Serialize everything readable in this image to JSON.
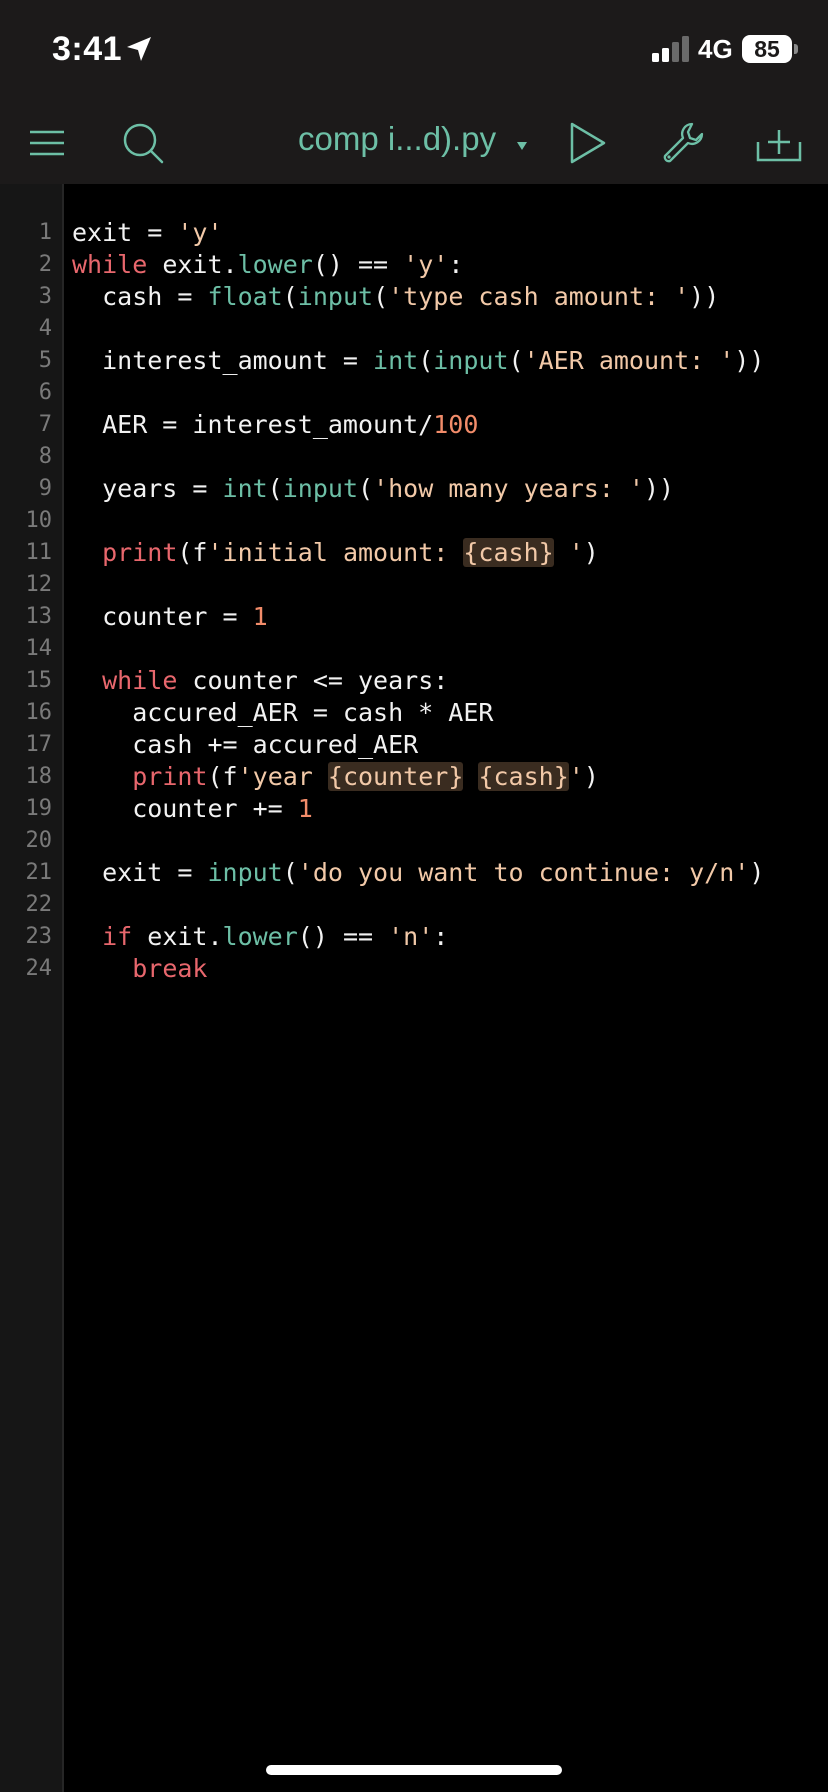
{
  "status_bar": {
    "time": "3:41",
    "network": "4G",
    "battery": "85",
    "icons": [
      "location-arrow-icon",
      "signal-bars-icon"
    ]
  },
  "toolbar": {
    "file_title": "comp i...d).py",
    "icons": [
      "menu-icon",
      "search-icon",
      "dropdown-caret-icon",
      "run-icon",
      "wrench-icon",
      "new-file-icon"
    ],
    "accent_color": "#6dbfa6"
  },
  "editor": {
    "colors": {
      "keyword": "#e8676d",
      "function": "#6dbfa6",
      "string": "#f2c9a8",
      "number": "#f28c6a",
      "text": "#f2f2f2",
      "line_number": "#7a7a7a"
    },
    "lines": [
      {
        "n": "1",
        "tokens": [
          {
            "t": "exit = ",
            "k": "txt"
          },
          {
            "t": "'y'",
            "k": "str"
          }
        ]
      },
      {
        "n": "2",
        "tokens": [
          {
            "t": "while",
            "k": "kw"
          },
          {
            "t": " exit.",
            "k": "txt"
          },
          {
            "t": "lower",
            "k": "fn"
          },
          {
            "t": "() == ",
            "k": "txt"
          },
          {
            "t": "'y'",
            "k": "str"
          },
          {
            "t": ":",
            "k": "txt"
          }
        ]
      },
      {
        "n": "3",
        "tokens": [
          {
            "t": "  cash = ",
            "k": "txt"
          },
          {
            "t": "float",
            "k": "fn"
          },
          {
            "t": "(",
            "k": "txt"
          },
          {
            "t": "input",
            "k": "fn"
          },
          {
            "t": "(",
            "k": "txt"
          },
          {
            "t": "'type cash amount: '",
            "k": "str"
          },
          {
            "t": "))",
            "k": "txt"
          }
        ]
      },
      {
        "n": "4",
        "tokens": []
      },
      {
        "n": "5",
        "tokens": [
          {
            "t": "  interest_amount = ",
            "k": "txt"
          },
          {
            "t": "int",
            "k": "fn"
          },
          {
            "t": "(",
            "k": "txt"
          },
          {
            "t": "input",
            "k": "fn"
          },
          {
            "t": "(",
            "k": "txt"
          },
          {
            "t": "'AER amount: '",
            "k": "str"
          },
          {
            "t": "))",
            "k": "txt"
          }
        ]
      },
      {
        "n": "6",
        "tokens": []
      },
      {
        "n": "7",
        "tokens": [
          {
            "t": "  AER = interest_amount/",
            "k": "txt"
          },
          {
            "t": "100",
            "k": "num"
          }
        ]
      },
      {
        "n": "8",
        "tokens": []
      },
      {
        "n": "9",
        "tokens": [
          {
            "t": "  years = ",
            "k": "txt"
          },
          {
            "t": "int",
            "k": "fn"
          },
          {
            "t": "(",
            "k": "txt"
          },
          {
            "t": "input",
            "k": "fn"
          },
          {
            "t": "(",
            "k": "txt"
          },
          {
            "t": "'how many years: '",
            "k": "str"
          },
          {
            "t": "))",
            "k": "txt"
          }
        ]
      },
      {
        "n": "10",
        "tokens": []
      },
      {
        "n": "11",
        "tokens": [
          {
            "t": "  ",
            "k": "txt"
          },
          {
            "t": "print",
            "k": "kw"
          },
          {
            "t": "(f",
            "k": "txt"
          },
          {
            "t": "'initial amount: ",
            "k": "str"
          },
          {
            "t": "{cash}",
            "k": "interp"
          },
          {
            "t": " '",
            "k": "str"
          },
          {
            "t": ")",
            "k": "txt"
          }
        ]
      },
      {
        "n": "12",
        "tokens": []
      },
      {
        "n": "13",
        "tokens": [
          {
            "t": "  counter = ",
            "k": "txt"
          },
          {
            "t": "1",
            "k": "num"
          }
        ]
      },
      {
        "n": "14",
        "tokens": []
      },
      {
        "n": "15",
        "tokens": [
          {
            "t": "  ",
            "k": "txt"
          },
          {
            "t": "while",
            "k": "kw"
          },
          {
            "t": " counter <= years:",
            "k": "txt"
          }
        ]
      },
      {
        "n": "16",
        "tokens": [
          {
            "t": "    accured_AER = cash * AER",
            "k": "txt"
          }
        ]
      },
      {
        "n": "17",
        "tokens": [
          {
            "t": "    cash += accured_AER",
            "k": "txt"
          }
        ]
      },
      {
        "n": "18",
        "tokens": [
          {
            "t": "    ",
            "k": "txt"
          },
          {
            "t": "print",
            "k": "kw"
          },
          {
            "t": "(f",
            "k": "txt"
          },
          {
            "t": "'year ",
            "k": "str"
          },
          {
            "t": "{counter}",
            "k": "interp"
          },
          {
            "t": " ",
            "k": "str"
          },
          {
            "t": "{cash}",
            "k": "interp"
          },
          {
            "t": "'",
            "k": "str"
          },
          {
            "t": ")",
            "k": "txt"
          }
        ]
      },
      {
        "n": "19",
        "tokens": [
          {
            "t": "    counter += ",
            "k": "txt"
          },
          {
            "t": "1",
            "k": "num"
          }
        ]
      },
      {
        "n": "20",
        "tokens": []
      },
      {
        "n": "21",
        "tokens": [
          {
            "t": "  exit = ",
            "k": "txt"
          },
          {
            "t": "input",
            "k": "fn"
          },
          {
            "t": "(",
            "k": "txt"
          },
          {
            "t": "'do you want to continue: y/n'",
            "k": "str"
          },
          {
            "t": ")",
            "k": "txt"
          }
        ]
      },
      {
        "n": "22",
        "tokens": []
      },
      {
        "n": "23",
        "tokens": [
          {
            "t": "  ",
            "k": "txt"
          },
          {
            "t": "if",
            "k": "kw"
          },
          {
            "t": " exit.",
            "k": "txt"
          },
          {
            "t": "lower",
            "k": "fn"
          },
          {
            "t": "() == ",
            "k": "txt"
          },
          {
            "t": "'n'",
            "k": "str"
          },
          {
            "t": ":",
            "k": "txt"
          }
        ]
      },
      {
        "n": "24",
        "tokens": [
          {
            "t": "    ",
            "k": "txt"
          },
          {
            "t": "break",
            "k": "kw"
          }
        ]
      }
    ]
  }
}
